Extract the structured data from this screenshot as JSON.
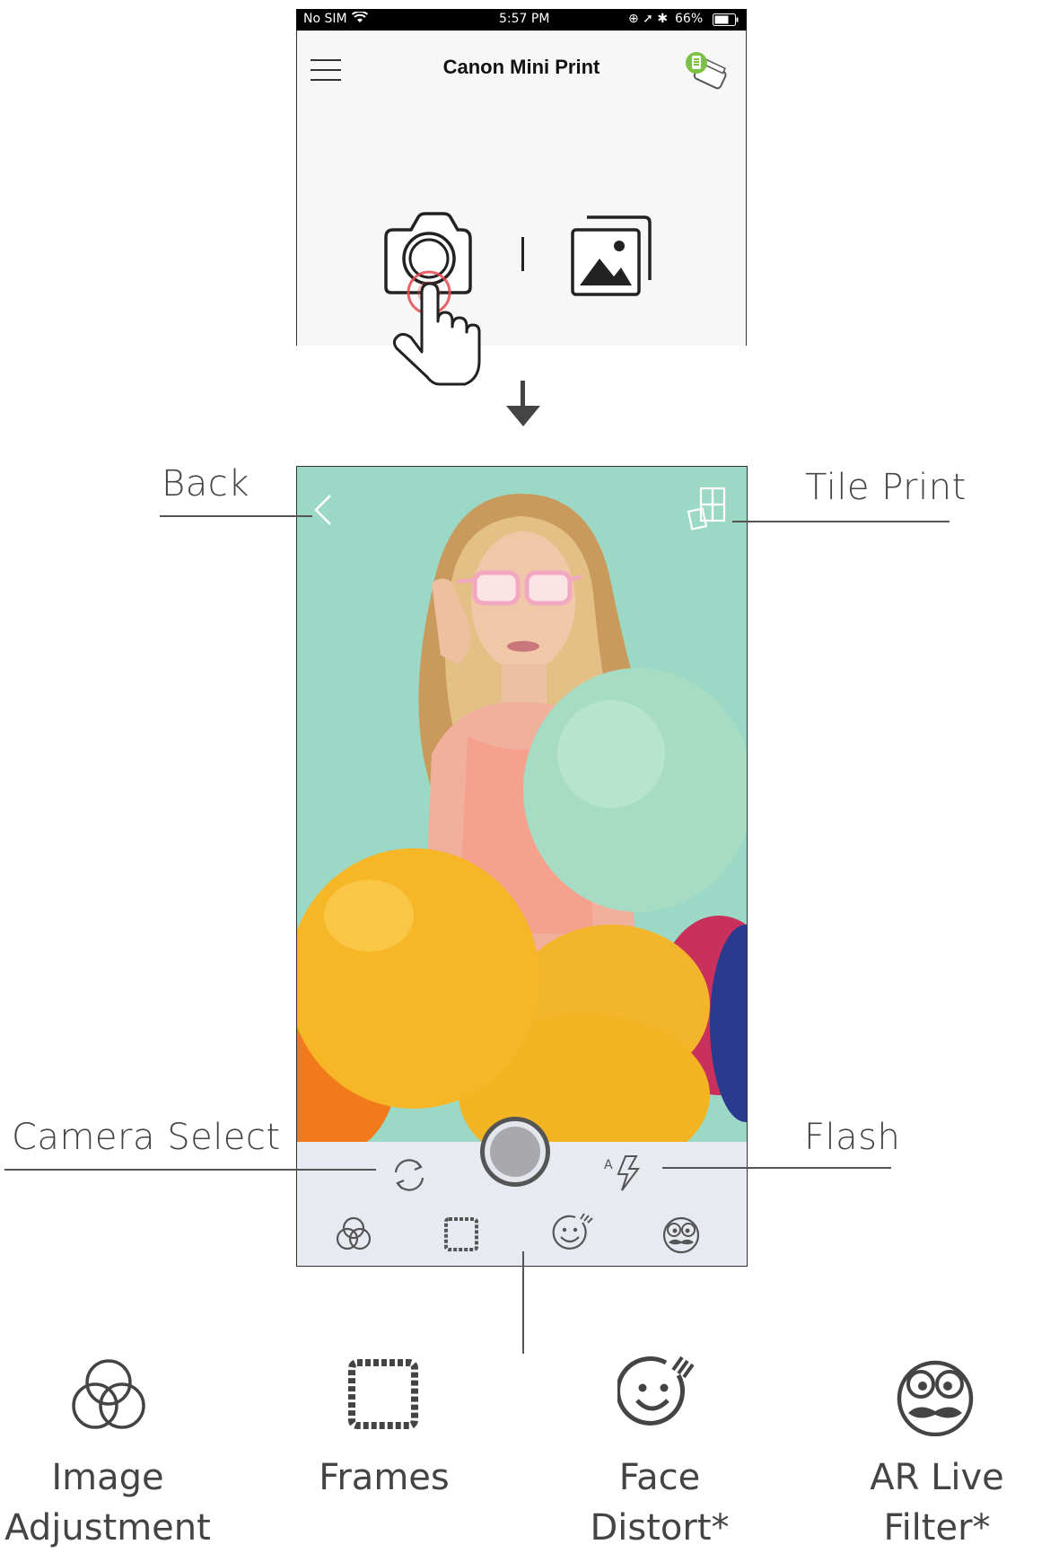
{
  "status_bar": {
    "carrier": "No SIM",
    "time": "5:57 PM",
    "battery": "66%"
  },
  "app": {
    "title": "Canon Mini Print"
  },
  "callouts": {
    "back": "Back",
    "tile_print": "Tile Print",
    "camera_select": "Camera Select",
    "flash": "Flash"
  },
  "features": [
    {
      "label_line1": "Image",
      "label_line2": "Adjustment",
      "icon": "rings-icon"
    },
    {
      "label_line1": "Frames",
      "label_line2": "",
      "icon": "frame-icon"
    },
    {
      "label_line1": "Face Distort*",
      "label_line2": "",
      "icon": "face-distort-icon"
    },
    {
      "label_line1": "AR Live Filter*",
      "label_line2": "",
      "icon": "ar-mustache-icon"
    }
  ],
  "colors": {
    "accent_red": "#e5484d",
    "toolbar_bg": "#e8eaf1",
    "photo_bg": "#9fd8c7",
    "battery_green": "#7cc242"
  }
}
